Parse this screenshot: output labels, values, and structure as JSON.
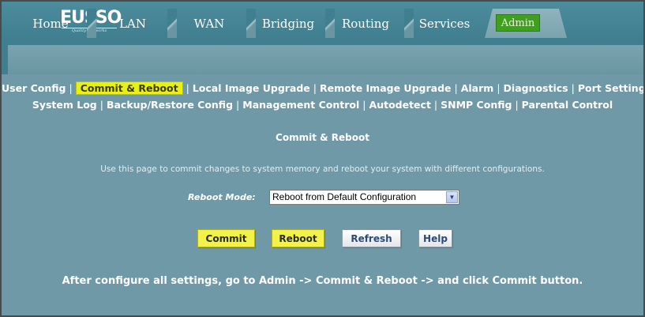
{
  "logo": {
    "text": "EUSSO",
    "tagline": "Quality Networks"
  },
  "tabs": [
    {
      "label": "Home"
    },
    {
      "label": "LAN"
    },
    {
      "label": "WAN"
    },
    {
      "label": "Bridging"
    },
    {
      "label": "Routing"
    },
    {
      "label": "Services"
    },
    {
      "label": "Admin",
      "active": true
    }
  ],
  "submenu": {
    "row1": [
      "User Config",
      "Commit & Reboot",
      "Local Image Upgrade",
      "Remote Image Upgrade",
      "Alarm",
      "Diagnostics",
      "Port Settings"
    ],
    "row2": [
      "System Log",
      "Backup/Restore Config",
      "Management Control",
      "Autodetect",
      "SNMP Config",
      "Parental Control"
    ],
    "active": "Commit & Reboot",
    "separator": "|"
  },
  "main": {
    "title": "Commit & Reboot",
    "description": "Use this page to commit changes to system memory and reboot your system with different configurations.",
    "reboot_mode_label": "Reboot Mode:",
    "reboot_mode_value": "Reboot from Default Configuration"
  },
  "buttons": {
    "commit": "Commit",
    "reboot": "Reboot",
    "refresh": "Refresh",
    "help": "Help"
  },
  "footer_note": "After configure all settings, go to Admin -> Commit & Reboot -> and click Commit button.",
  "colors": {
    "background": "#6f99a6",
    "header": "#3f7f8f",
    "highlight": "#e8f018",
    "active_tab": "#3fa020"
  }
}
